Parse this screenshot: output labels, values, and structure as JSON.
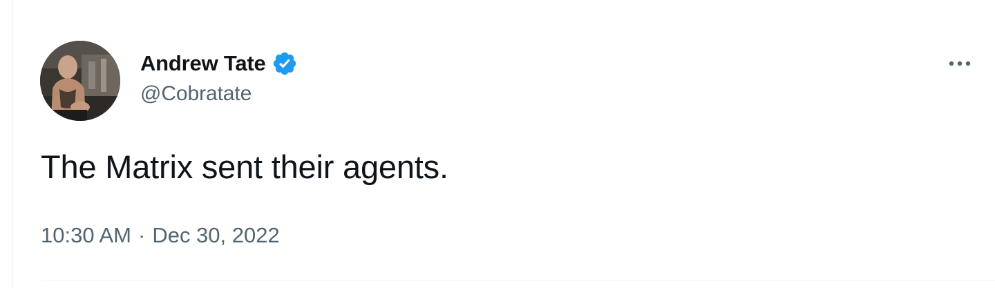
{
  "tweet": {
    "author": {
      "name": "Andrew Tate",
      "handle": "@Cobratate",
      "verified": true,
      "verified_color": "#1d9bf0"
    },
    "text": "The Matrix sent their agents.",
    "time": "10:30 AM",
    "separator": "·",
    "date": "Dec 30, 2022",
    "more_icon": "more-horizontal-icon"
  },
  "colors": {
    "text_primary": "#0f1419",
    "text_secondary": "#536471",
    "divider": "#eff3f4"
  }
}
